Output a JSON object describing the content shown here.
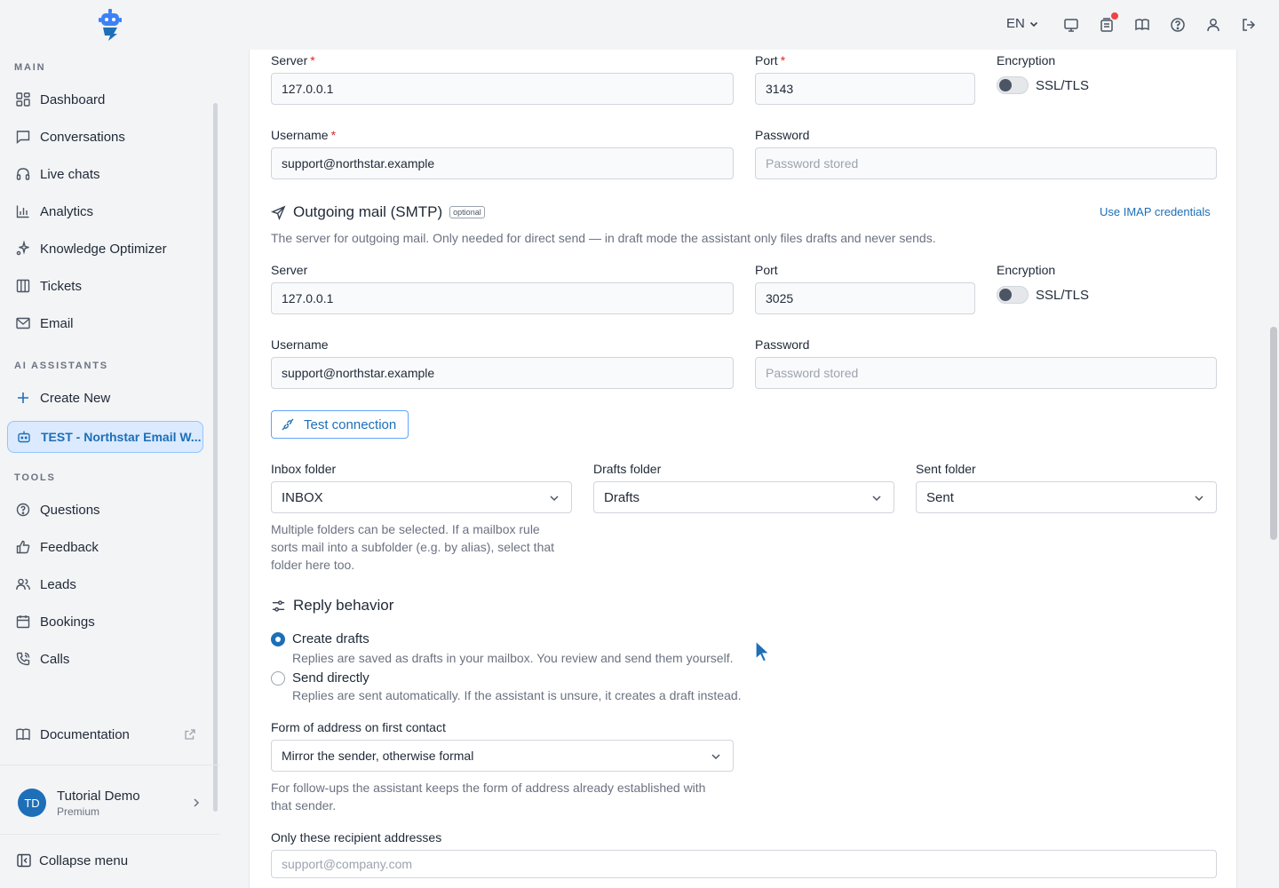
{
  "header": {
    "language": "EN",
    "icons": [
      "monitor-icon",
      "notifications-icon",
      "book-open-icon",
      "help-icon",
      "user-icon",
      "logout-icon"
    ]
  },
  "sidebar": {
    "sections": {
      "main": "MAIN",
      "ai_assistants": "AI ASSISTANTS",
      "tools": "TOOLS"
    },
    "main_items": [
      {
        "label": "Dashboard",
        "icon": "dashboard-icon"
      },
      {
        "label": "Conversations",
        "icon": "chat-icon"
      },
      {
        "label": "Live chats",
        "icon": "headset-icon"
      },
      {
        "label": "Analytics",
        "icon": "bar-chart-icon"
      },
      {
        "label": "Knowledge Optimizer",
        "icon": "sparkle-icon"
      },
      {
        "label": "Tickets",
        "icon": "columns-icon"
      },
      {
        "label": "Email",
        "icon": "mail-icon"
      }
    ],
    "create_new": "Create New",
    "active_assistant": "TEST - Northstar Email W...",
    "tool_items": [
      {
        "label": "Questions",
        "icon": "question-icon"
      },
      {
        "label": "Feedback",
        "icon": "thumbs-up-icon"
      },
      {
        "label": "Leads",
        "icon": "users-icon"
      },
      {
        "label": "Bookings",
        "icon": "calendar-icon"
      },
      {
        "label": "Calls",
        "icon": "phone-icon"
      }
    ],
    "documentation": "Documentation",
    "profile": {
      "initials": "TD",
      "name": "Tutorial Demo",
      "plan": "Premium"
    },
    "collapse": "Collapse menu"
  },
  "imap": {
    "server_label": "Server",
    "server_value": "127.0.0.1",
    "port_label": "Port",
    "port_value": "3143",
    "encryption_label": "Encryption",
    "encryption_option": "SSL/TLS",
    "username_label": "Username",
    "username_value": "support@northstar.example",
    "password_label": "Password",
    "password_placeholder": "Password stored"
  },
  "smtp": {
    "title": "Outgoing mail (SMTP)",
    "badge": "optional",
    "use_imap_link": "Use IMAP credentials",
    "description": "The server for outgoing mail. Only needed for direct send — in draft mode the assistant only files drafts and never sends.",
    "server_label": "Server",
    "server_value": "127.0.0.1",
    "port_label": "Port",
    "port_value": "3025",
    "encryption_label": "Encryption",
    "encryption_option": "SSL/TLS",
    "username_label": "Username",
    "username_value": "support@northstar.example",
    "password_label": "Password",
    "password_placeholder": "Password stored",
    "test_button": "Test connection"
  },
  "folders": {
    "inbox_label": "Inbox folder",
    "inbox_value": "INBOX",
    "drafts_label": "Drafts folder",
    "drafts_value": "Drafts",
    "sent_label": "Sent folder",
    "sent_value": "Sent",
    "hint_line1": "Multiple folders can be selected. If a mailbox rule",
    "hint_line2": "sorts mail into a subfolder (e.g. by alias), select that",
    "hint_line3": "folder here too."
  },
  "reply": {
    "title": "Reply behavior",
    "option1_title": "Create drafts",
    "option1_desc": "Replies are saved as drafts in your mailbox. You review and send them yourself.",
    "option1_selected": true,
    "option2_title": "Send directly",
    "option2_desc": "Replies are sent automatically. If the assistant is unsure, it creates a draft instead.",
    "address_label": "Form of address on first contact",
    "address_value": "Mirror the sender, otherwise formal",
    "address_hint_line1": "For follow-ups the assistant keeps the form of address already established with",
    "address_hint_line2": "that sender.",
    "recipients_label": "Only these recipient addresses",
    "recipients_placeholder": "support@company.com"
  },
  "colors": {
    "accent": "#1d6fb8",
    "required": "#dc2626",
    "notification": "#ef4444"
  }
}
